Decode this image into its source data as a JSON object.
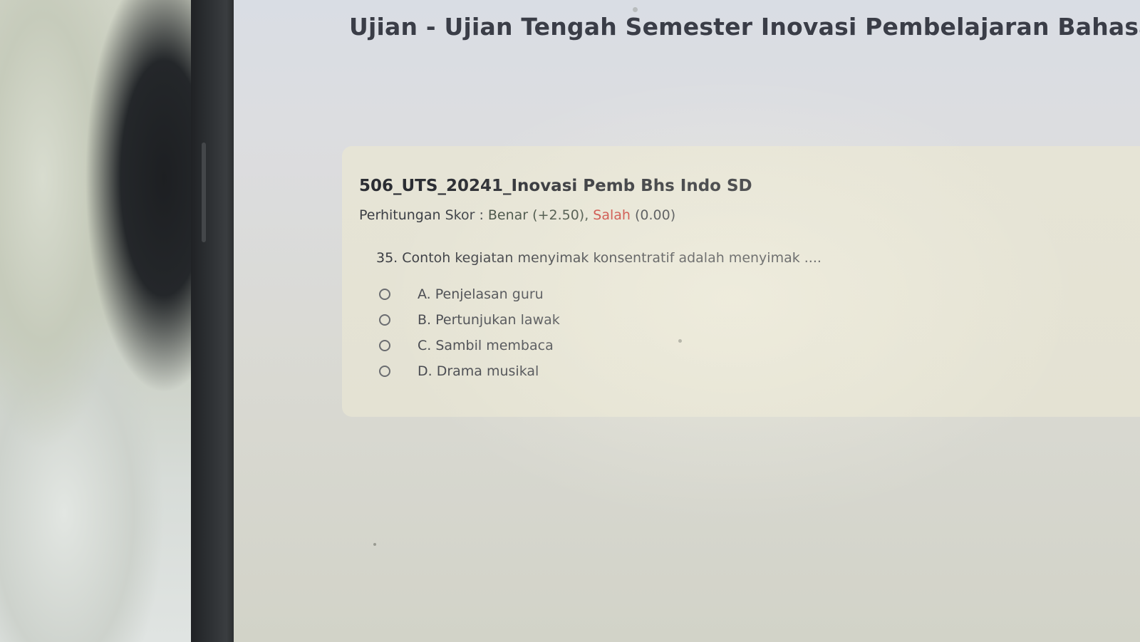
{
  "exam": {
    "title": "Ujian - Ujian Tengah Semester Inovasi Pembelajaran Bahasa Indo"
  },
  "card": {
    "title": "506_UTS_20241_Inovasi Pemb Bhs Indo SD",
    "score_prefix": "Perhitungan Skor : ",
    "score_correct": "Benar (+2.50),",
    "score_wrong": "Salah",
    "score_wrong_value": "(0.00)"
  },
  "question": {
    "text": "35. Contoh kegiatan menyimak konsentratif adalah menyimak ....",
    "options": [
      {
        "label": "A. Penjelasan guru",
        "selected": false
      },
      {
        "label": "B. Pertunjukan lawak",
        "selected": false
      },
      {
        "label": "C. Sambil membaca",
        "selected": false
      },
      {
        "label": "D. Drama musikal",
        "selected": false
      }
    ]
  },
  "colors": {
    "wrong_score": "#c9403a",
    "title_text": "#3a3d47"
  }
}
